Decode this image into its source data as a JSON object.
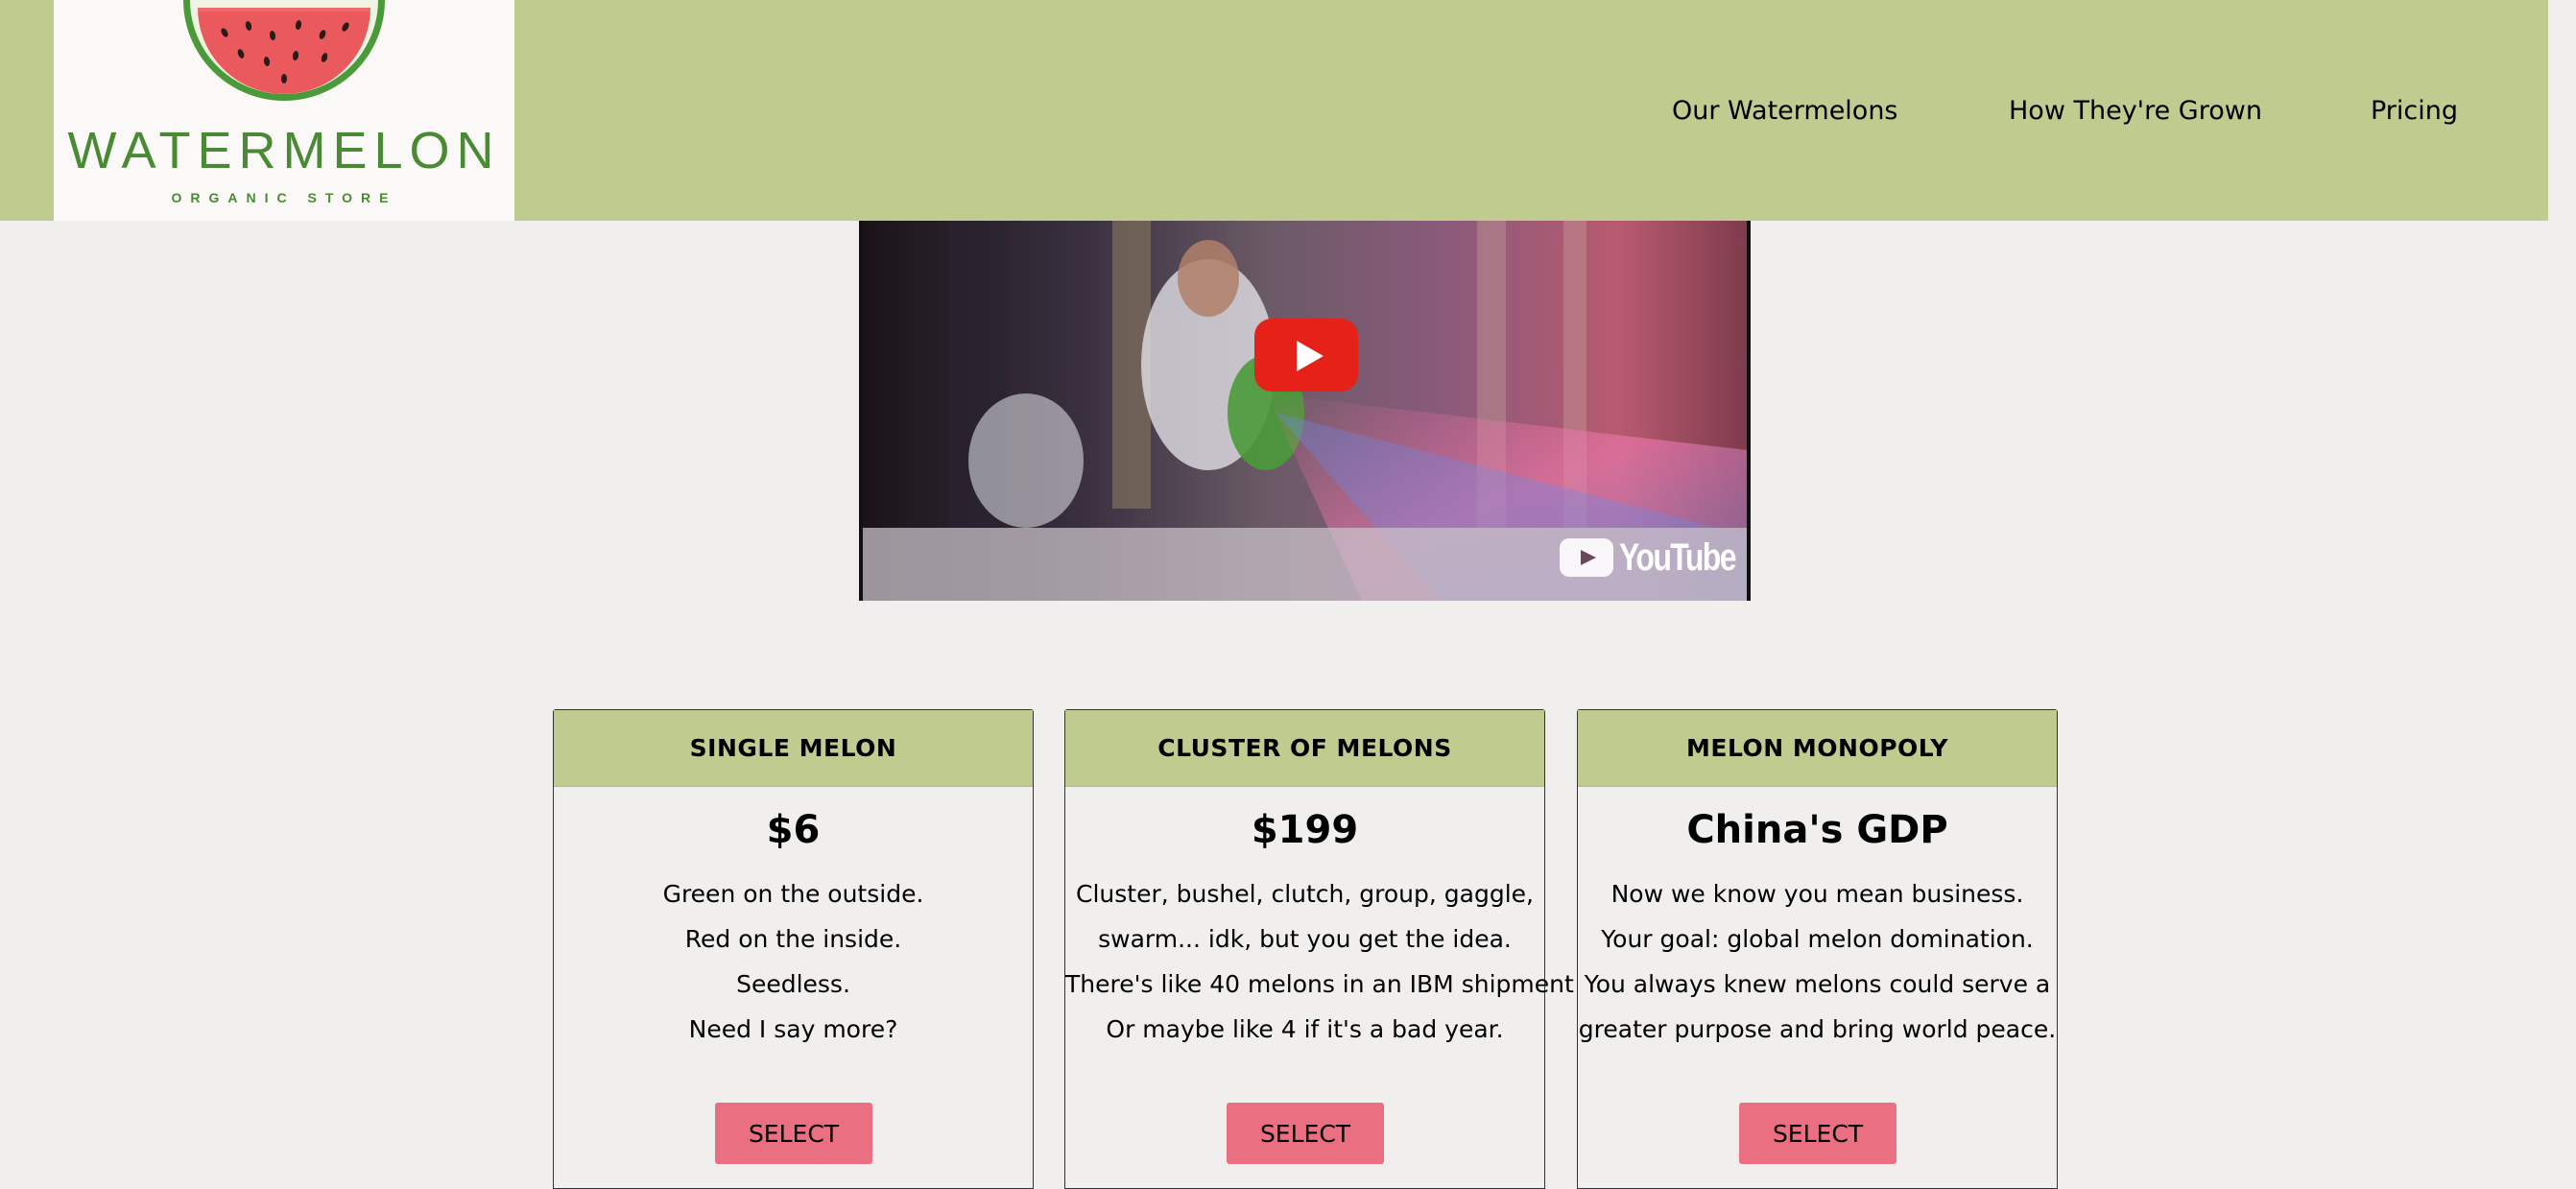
{
  "header": {
    "brand": "WATERMELON",
    "tagline": "ORGANIC STORE",
    "nav": [
      {
        "label": "Our Watermelons"
      },
      {
        "label": "How They're Grown"
      },
      {
        "label": "Pricing"
      }
    ]
  },
  "video": {
    "provider_label": "YouTube"
  },
  "plans": [
    {
      "title": "SINGLE MELON",
      "price": "$6",
      "lines": [
        "Green on the outside.",
        "Red on the inside.",
        "Seedless.",
        "Need I say more?"
      ],
      "button": "SELECT"
    },
    {
      "title": "CLUSTER OF MELONS",
      "price": "$199",
      "lines": [
        "Cluster, bushel, clutch, group, gaggle,",
        "swarm... idk, but you get the idea.",
        "There's like 40 melons in an IBM shipment",
        "Or maybe like 4 if it's a bad year."
      ],
      "button": "SELECT"
    },
    {
      "title": "MELON MONOPOLY",
      "price": "China's GDP",
      "lines": [
        "Now we know you mean business.",
        "Your goal: global melon domination.",
        "You always knew melons could serve a",
        "greater purpose and bring world peace."
      ],
      "button": "SELECT"
    }
  ],
  "colors": {
    "header_bg": "#c0cb90",
    "page_bg": "#f0efee",
    "button_bg": "#ea6f80",
    "brand_green": "#4a8a34",
    "youtube_red": "#e62117"
  },
  "icons": {
    "logo": "watermelon-slice-icon",
    "play": "play-icon"
  }
}
